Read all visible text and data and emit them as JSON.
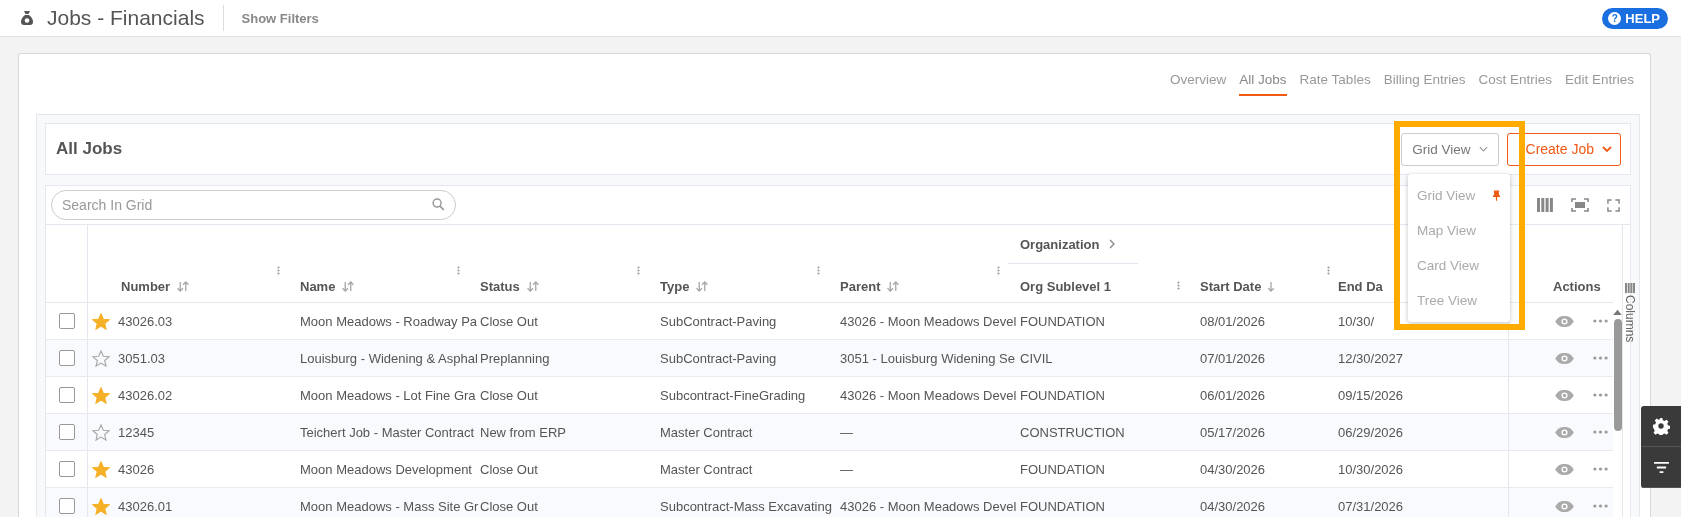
{
  "header": {
    "title": "Jobs - Financials",
    "filters_link": "Show Filters",
    "help_icon": "?",
    "help": "HELP"
  },
  "nav_tabs": [
    {
      "label": "Overview",
      "selected": false
    },
    {
      "label": "All Jobs",
      "selected": true
    },
    {
      "label": "Rate Tables",
      "selected": false
    },
    {
      "label": "Billing Entries",
      "selected": false
    },
    {
      "label": "Cost Entries",
      "selected": false
    },
    {
      "label": "Edit Entries",
      "selected": false
    }
  ],
  "panel": {
    "title": "All Jobs",
    "view_button": "Grid View",
    "create_button": "Create Job"
  },
  "view_menu": {
    "items": [
      {
        "label": "Grid View",
        "pinned": true
      },
      {
        "label": "Map View",
        "pinned": false
      },
      {
        "label": "Card View",
        "pinned": false
      },
      {
        "label": "Tree View",
        "pinned": false
      }
    ]
  },
  "grid": {
    "search": {
      "placeholder": "Search In Grid"
    },
    "side_panel": "Columns",
    "columns": [
      {
        "label": "Number",
        "kind": "sortable",
        "menu": true
      },
      {
        "label": "Name",
        "kind": "sortable",
        "menu": true
      },
      {
        "label": "Status",
        "kind": "sortable",
        "menu": true
      },
      {
        "label": "Type",
        "kind": "sortable",
        "menu": true
      },
      {
        "label": "Parent",
        "kind": "sortable",
        "menu": true
      },
      {
        "group_label": "Organization",
        "label": "Org Sublevel 1",
        "kind": "plain",
        "menu": true
      },
      {
        "label": "Start Date",
        "kind": "descending",
        "menu": true
      },
      {
        "label": "End Da",
        "kind": "plain"
      },
      {
        "label": "Actions",
        "kind": "plain",
        "menu": false
      }
    ],
    "rows": [
      {
        "checked": false,
        "starred": true,
        "cells": [
          "43026.03",
          "Moon Meadows - Roadway Pa",
          "Close Out",
          "SubContract-Paving",
          "43026 - Moon Meadows Devel",
          "FOUNDATION",
          "08/01/2026",
          "10/30/"
        ]
      },
      {
        "checked": false,
        "starred": false,
        "cells": [
          "3051.03",
          "Louisburg - Widening & Asphal",
          "Preplanning",
          "SubContract-Paving",
          "3051 - Louisburg Widening Se",
          "CIVIL",
          "07/01/2026",
          "12/30/2027"
        ]
      },
      {
        "checked": false,
        "starred": true,
        "cells": [
          "43026.02",
          "Moon Meadows - Lot Fine Gra",
          "Close Out",
          "Subcontract-FineGrading",
          "43026 - Moon Meadows Devel",
          "FOUNDATION",
          "06/01/2026",
          "09/15/2026"
        ]
      },
      {
        "checked": false,
        "starred": false,
        "cells": [
          "12345",
          "Teichert Job - Master Contract",
          "New from ERP",
          "Master Contract",
          "—",
          "CONSTRUCTION",
          "05/17/2026",
          "06/29/2026"
        ]
      },
      {
        "checked": false,
        "starred": true,
        "cells": [
          "43026",
          "Moon Meadows Development",
          "Close Out",
          "Master Contract",
          "—",
          "FOUNDATION",
          "04/30/2026",
          "10/30/2026"
        ]
      },
      {
        "checked": false,
        "starred": true,
        "cells": [
          "43026.01",
          "Moon Meadows - Mass Site Gr",
          "Close Out",
          "Subcontract-Mass Excavating",
          "43026 - Moon Meadows Devel",
          "FOUNDATION",
          "04/30/2026",
          "07/31/2026"
        ]
      }
    ]
  }
}
